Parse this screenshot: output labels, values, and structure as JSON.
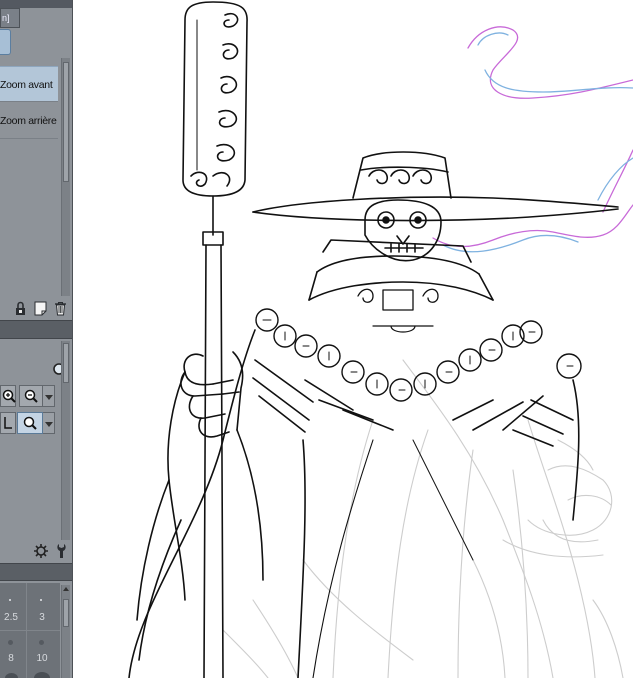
{
  "panel": {
    "set_tab_label": "n]",
    "zoom_items": [
      "Zoom avant",
      "Zoom arrière"
    ],
    "brush_sizes": [
      "2.5",
      "3",
      "8",
      "10"
    ]
  },
  "icons": {
    "layer_lock": "lock-icon",
    "new_page": "new-page-icon",
    "trash": "trash-icon",
    "magnify": "magnifier-icon",
    "zoom_in": "zoom-in-icon",
    "zoom_out": "zoom-out-icon",
    "settings": "gear-icon",
    "wrench": "wrench-icon"
  },
  "colors": {
    "panel_bg": "#8e9399",
    "panel_bar": "#5a5f65",
    "selected_item": "#b3c6d8",
    "ink": "#111111",
    "sketch": "#c9c9c9",
    "smoke_pink": "#c86ad8",
    "smoke_blue": "#7fb2e0"
  }
}
